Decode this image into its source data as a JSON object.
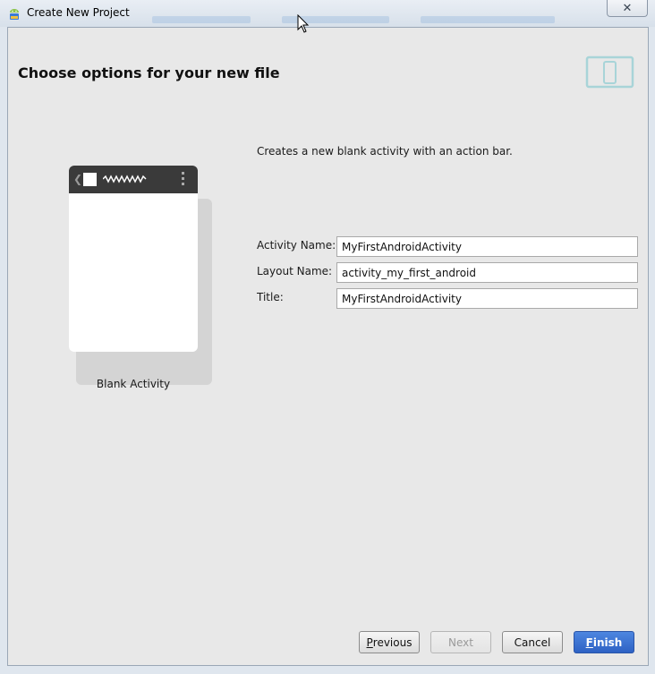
{
  "window": {
    "title": "Create New Project",
    "close_glyph": "✕"
  },
  "page": {
    "heading": "Choose options for your new file",
    "description": "Creates a new blank activity with an action bar."
  },
  "preview": {
    "label": "Blank Activity",
    "back_glyph": "❮"
  },
  "form": {
    "fields": [
      {
        "label": "Activity Name:",
        "value": "MyFirstAndroidActivity"
      },
      {
        "label": "Layout Name:",
        "value": "activity_my_first_android"
      },
      {
        "label": "Title:",
        "value": "MyFirstAndroidActivity"
      }
    ]
  },
  "buttons": {
    "previous": {
      "mnemonic": "P",
      "rest": "revious"
    },
    "next": {
      "label": "Next"
    },
    "cancel": {
      "label": "Cancel"
    },
    "finish": {
      "mnemonic": "F",
      "rest": "inish"
    }
  },
  "colors": {
    "accent": "#3f76d6",
    "dialog_background": "#e8e8e8",
    "phone_bar": "#3a3a3a"
  },
  "icons": [
    "android-icon",
    "close-icon",
    "tablet-icon",
    "mouse-cursor-icon"
  ]
}
